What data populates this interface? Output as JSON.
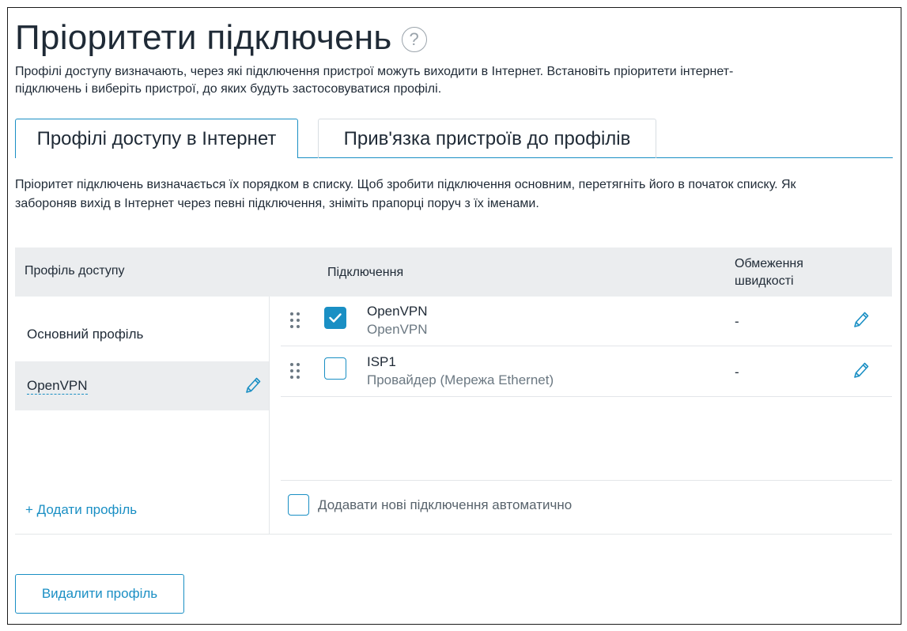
{
  "page": {
    "title": "Пріоритети підключень",
    "help_icon": "question-circle-icon",
    "intro_line1": "Профілі доступу визначають, через які підключення пристрої можуть виходити в Інтернет. Встановіть пріоритети інтернет-",
    "intro_line2": "підключень і виберіть пристрої, до яких будуть застосовуватися профілі."
  },
  "tabs": [
    {
      "label": "Профілі доступу в Інтернет",
      "active": true
    },
    {
      "label": "Прив'язка пристроїв до профілів",
      "active": false
    }
  ],
  "description": {
    "line1": "Пріоритет підключень визначається їх порядком в списку. Щоб зробити підключення основним, перетягніть його в початок списку. Як",
    "line2": "забороняв вихід в Інтернет через певні підключення, зніміть прапорці поруч з їх іменами."
  },
  "table": {
    "headers": {
      "profile": "Профіль доступу",
      "connection": "Підключення",
      "speed_line1": "Обмеження",
      "speed_line2": "швидкості"
    },
    "profiles": [
      {
        "label": "Основний профіль",
        "selected": false
      },
      {
        "label": "OpenVPN",
        "selected": true
      }
    ],
    "connections": [
      {
        "name": "OpenVPN",
        "subtitle": "OpenVPN",
        "checked": true,
        "speed": "-"
      },
      {
        "name": "ISP1",
        "subtitle": "Провайдер (Мережа Ethernet)",
        "checked": false,
        "speed": "-"
      }
    ],
    "add_profile": "+ Додати профіль",
    "auto_add": {
      "label": "Додавати нові підключення автоматично",
      "checked": false
    }
  },
  "actions": {
    "delete_profile": "Видалити профіль"
  },
  "colors": {
    "accent": "#1a8fc4",
    "header_bg": "#ebedef",
    "text": "#1f2a36",
    "muted": "#6b7882"
  }
}
